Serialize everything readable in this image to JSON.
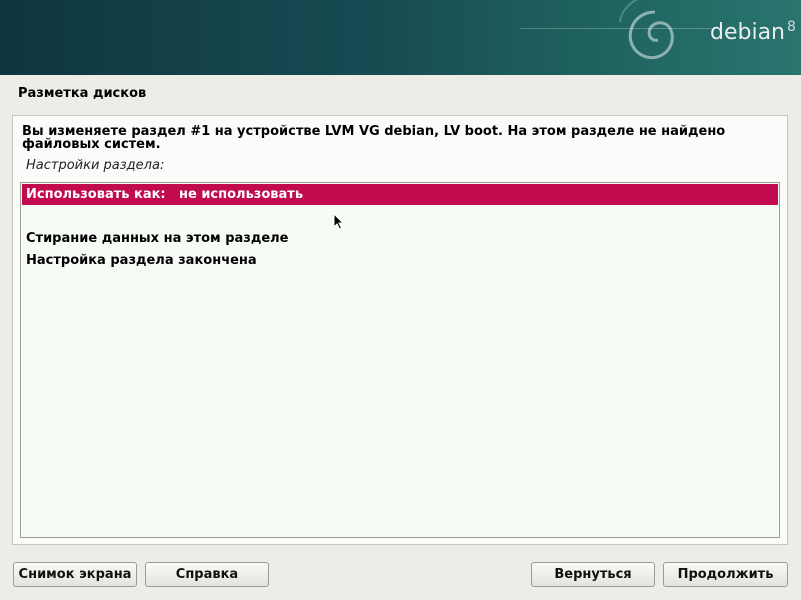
{
  "header": {
    "brand": "debian",
    "version": "8"
  },
  "page": {
    "title": "Разметка дисков",
    "description": "Вы изменяете раздел #1 на устройстве LVM VG debian, LV boot. На этом разделе не найдено файловых систем.",
    "sublabel": "Настройки раздела:"
  },
  "options": [
    {
      "label": "Использовать как:",
      "value": "не использовать",
      "selected": true
    },
    {
      "label": "Стирание данных на этом разделе",
      "value": "",
      "selected": false
    },
    {
      "label": "Настройка раздела закончена",
      "value": "",
      "selected": false
    }
  ],
  "buttons": {
    "screenshot": "Снимок экрана",
    "help": "Справка",
    "back": "Вернуться",
    "continue": "Продолжить"
  },
  "colors": {
    "selection": "#c20b4e",
    "banner": "#174a52"
  }
}
